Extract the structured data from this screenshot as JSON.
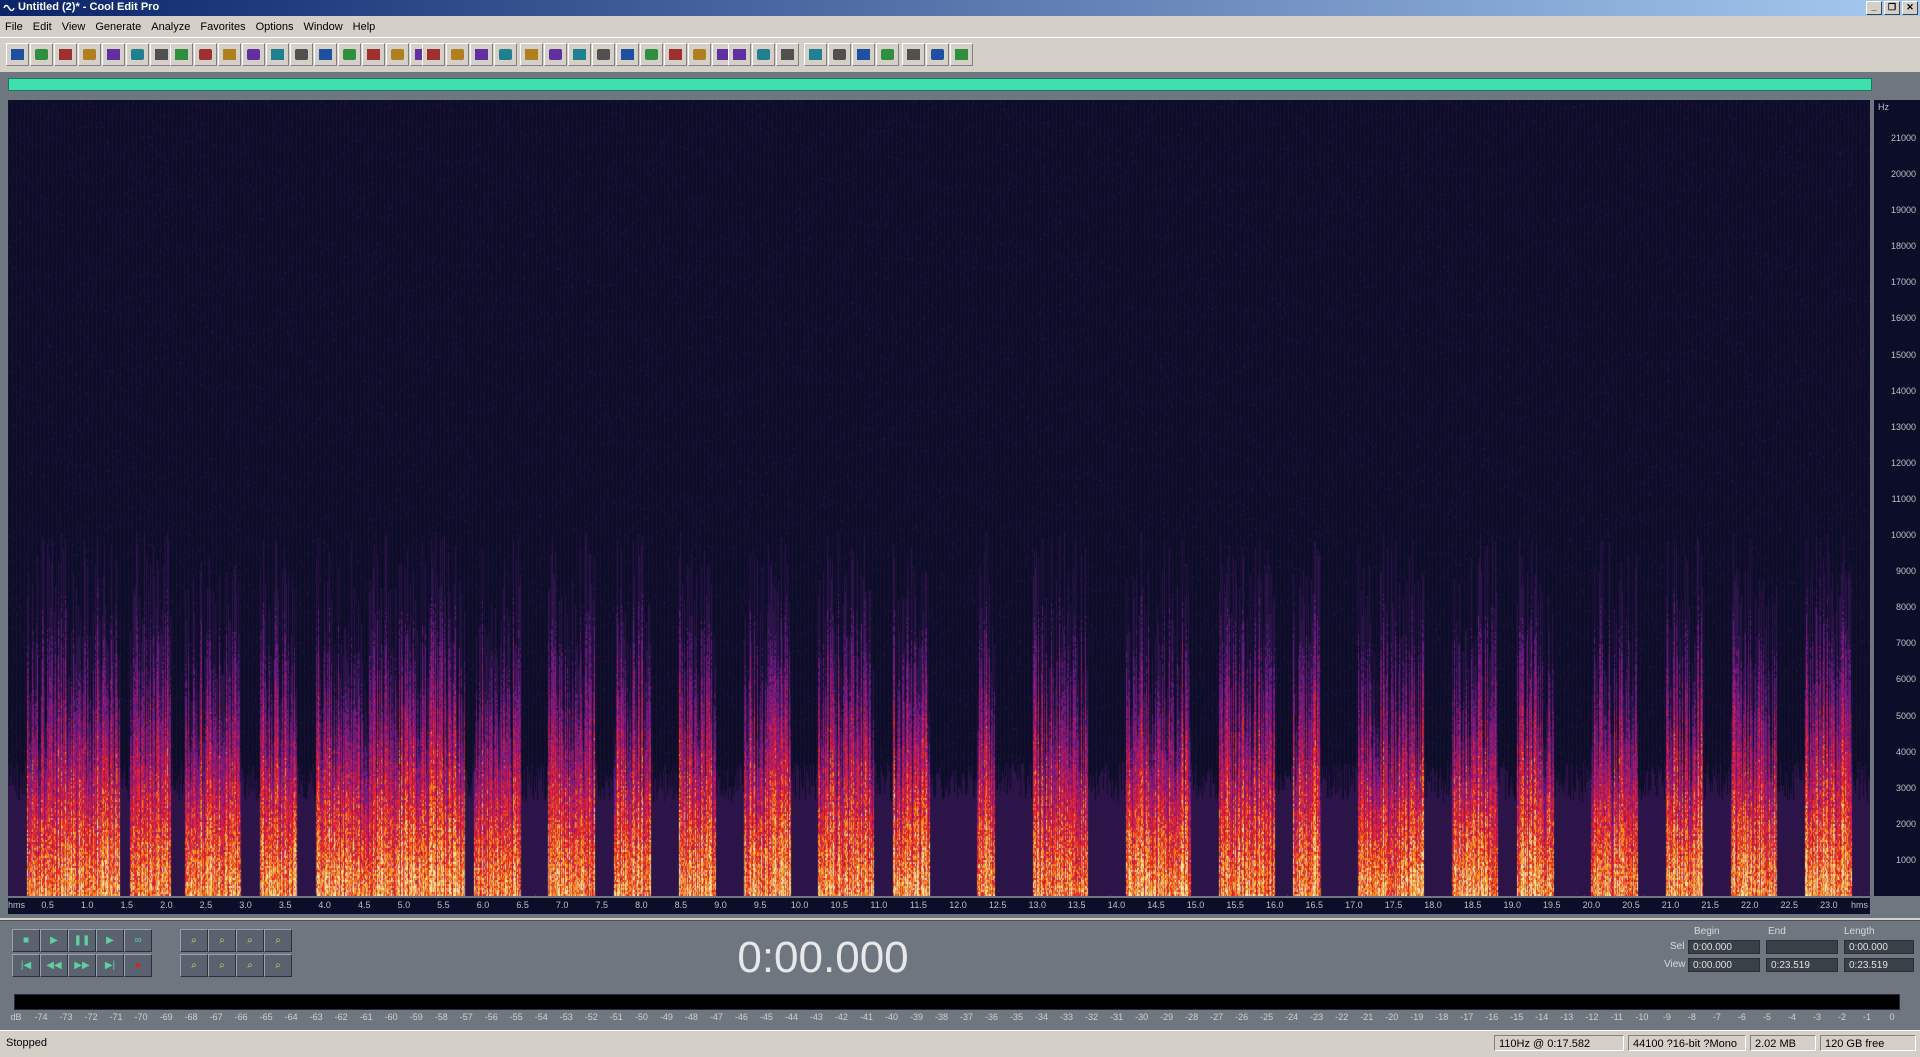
{
  "window": {
    "title": "Untitled (2)* - Cool Edit Pro",
    "minimize": "_",
    "restore": "❐",
    "close": "✕"
  },
  "menu": [
    "File",
    "Edit",
    "View",
    "Generate",
    "Analyze",
    "Favorites",
    "Options",
    "Window",
    "Help"
  ],
  "toolbar": {
    "groups": [
      {
        "icons": [
          "waveform-view-icon",
          "multitrack-view-icon",
          "new-file-icon",
          "open-file-icon",
          "save-file-icon",
          "close-file-icon",
          "window-icon"
        ]
      },
      {
        "icons": [
          "undo-icon",
          "redo-icon",
          "repeat-icon",
          "copy-icon",
          "copy-new-icon",
          "cut-icon",
          "paste-icon",
          "paste-new-icon",
          "mix-paste-icon",
          "trim-icon",
          "find-icon"
        ]
      },
      {
        "icons": [
          "amplify-icon",
          "envelope-icon",
          "normalize-icon",
          "noise-icon"
        ]
      },
      {
        "icons": [
          "spectral-view-icon",
          "waveform-icon",
          "frequency-icon",
          "play-icon",
          "zoom-icon",
          "time-format-icon",
          "bar-beat-icon",
          "metronome-icon",
          "grid-icon"
        ]
      },
      {
        "icons": [
          "cue-icon",
          "settings-icon",
          "help-icon"
        ]
      },
      {
        "icons": [
          "effect1-icon",
          "effect2-icon",
          "effect3-icon",
          "effect4-icon"
        ]
      },
      {
        "icons": [
          "analysis-icon",
          "scale-icon",
          "expand-icon"
        ]
      }
    ]
  },
  "spectrogram": {
    "freq_unit": "Hz",
    "freq_labels": [
      "21000",
      "20000",
      "19000",
      "18000",
      "17000",
      "16000",
      "15000",
      "14000",
      "13000",
      "12000",
      "11000",
      "10000",
      "9000",
      "8000",
      "7000",
      "6000",
      "5000",
      "4000",
      "3000",
      "2000",
      "1000"
    ],
    "time_unit": "hms",
    "time_labels": [
      "0.5",
      "1.0",
      "1.5",
      "2.0",
      "2.5",
      "3.0",
      "3.5",
      "4.0",
      "4.5",
      "5.0",
      "5.5",
      "6.0",
      "6.5",
      "7.0",
      "7.5",
      "8.0",
      "8.5",
      "9.0",
      "9.5",
      "10.0",
      "10.5",
      "11.0",
      "11.5",
      "12.0",
      "12.5",
      "13.0",
      "13.5",
      "14.0",
      "14.5",
      "15.0",
      "15.5",
      "16.0",
      "16.5",
      "17.0",
      "17.5",
      "18.0",
      "18.5",
      "19.0",
      "19.5",
      "20.0",
      "20.5",
      "21.0",
      "21.5",
      "22.0",
      "22.5",
      "23.0"
    ],
    "duration": 23.519,
    "max_freq": 22050
  },
  "transport": {
    "row1": [
      "stop-icon",
      "play-icon",
      "pause-icon",
      "play-from-cursor-icon",
      "loop-icon"
    ],
    "row2": [
      "go-start-icon",
      "rewind-icon",
      "fast-forward-icon",
      "go-end-icon",
      "record-icon"
    ],
    "zoom_row1": [
      "zoom-in-h-icon",
      "zoom-out-h-icon",
      "zoom-full-icon",
      "zoom-in-v-icon"
    ],
    "zoom_row2": [
      "zoom-left-icon",
      "zoom-right-icon",
      "zoom-sel-icon",
      "zoom-out-v-icon"
    ]
  },
  "time_display": "0:00.000",
  "selection": {
    "begin_label": "Begin",
    "end_label": "End",
    "length_label": "Length",
    "sel_label": "Sel",
    "view_label": "View",
    "sel_begin": "0:00.000",
    "sel_end": "",
    "sel_length": "0:00.000",
    "view_begin": "0:00.000",
    "view_end": "0:23.519",
    "view_length": "0:23.519"
  },
  "level_meter": {
    "labels": [
      "dB",
      "-74",
      "-73",
      "-72",
      "-71",
      "-70",
      "-69",
      "-68",
      "-67",
      "-66",
      "-65",
      "-64",
      "-63",
      "-62",
      "-61",
      "-60",
      "-59",
      "-58",
      "-57",
      "-56",
      "-55",
      "-54",
      "-53",
      "-52",
      "-51",
      "-50",
      "-49",
      "-48",
      "-47",
      "-46",
      "-45",
      "-44",
      "-43",
      "-42",
      "-41",
      "-40",
      "-39",
      "-38",
      "-37",
      "-36",
      "-35",
      "-34",
      "-33",
      "-32",
      "-31",
      "-30",
      "-29",
      "-28",
      "-27",
      "-26",
      "-25",
      "-24",
      "-23",
      "-22",
      "-21",
      "-20",
      "-19",
      "-18",
      "-17",
      "-16",
      "-15",
      "-14",
      "-13",
      "-12",
      "-11",
      "-10",
      "-9",
      "-8",
      "-7",
      "-6",
      "-5",
      "-4",
      "-3",
      "-2",
      "-1",
      "0"
    ]
  },
  "status": {
    "state": "Stopped",
    "cursor": "110Hz @  0:17.582",
    "format": "44100 ?16-bit ?Mono",
    "size": "2.02 MB",
    "free": "120 GB free"
  },
  "colors": {
    "spectrogram_bg": "#0c0d28",
    "panel": "#6e7780",
    "overview": "#3fdfb0",
    "title_start": "#0a246a",
    "title_end": "#a6caf0"
  }
}
